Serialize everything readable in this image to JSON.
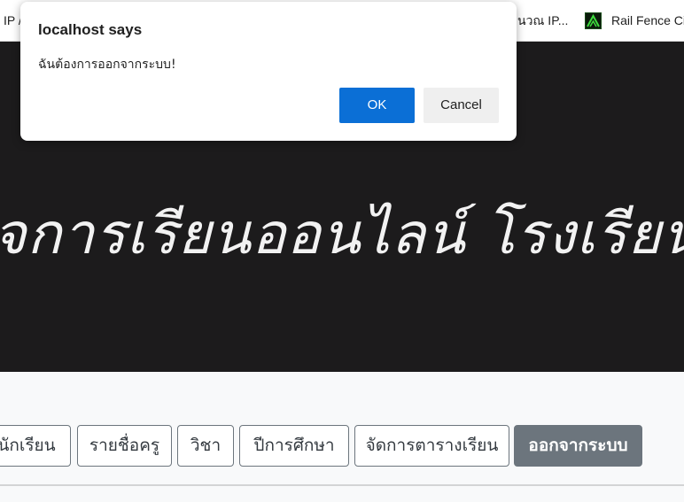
{
  "bookmarks": {
    "item_1": "IP /",
    "item_2": "นวณ IP...",
    "item_3": "Rail Fence Ci",
    "item_3_icon": "rail-fence-icon"
  },
  "hero": {
    "title": "จการเรียนออนไลน์ โรงเรียนบ้านบ"
  },
  "nav": {
    "buttons": [
      "นักเรียน",
      "รายชื่อครู",
      "วิชา",
      "ปีการศึกษา",
      "จัดการตารางเรียน",
      "ออกจากระบบ"
    ],
    "active_index": 5
  },
  "dialog": {
    "title": "localhost says",
    "message": "ฉันต้องการออกจากระบบ!",
    "ok_label": "OK",
    "cancel_label": "Cancel"
  },
  "colors": {
    "hero_bg": "#1c1b1c",
    "ok_button": "#0b6fd6",
    "active_nav": "#6c757d"
  }
}
